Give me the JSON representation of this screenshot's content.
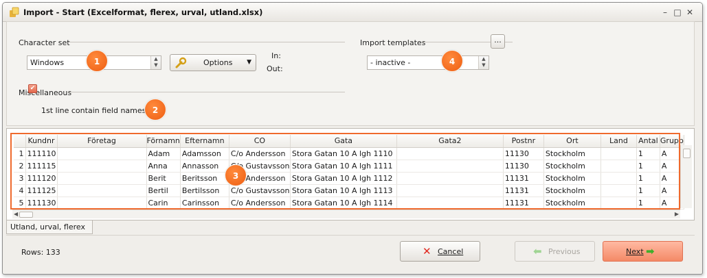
{
  "window": {
    "title": "Import - Start  (Excelformat, flerex, urval, utland.xlsx)",
    "controls": [
      "–",
      "□",
      "✕"
    ]
  },
  "character_set": {
    "section_label": "Character set",
    "value": "Windows",
    "options_label": "Options",
    "in_label": "In:",
    "out_label": "Out:"
  },
  "import_templates": {
    "section_label": "Import templates",
    "value": "- inactive -",
    "browse_label": "..."
  },
  "miscellaneous": {
    "section_label": "Miscellaneous",
    "checkbox_label": "1st line contain field names",
    "checked": true
  },
  "badges": [
    "1",
    "2",
    "3",
    "4"
  ],
  "grid": {
    "columns": [
      "Kundnr",
      "Företag",
      "Förnamn",
      "Efternamn",
      "CO",
      "Gata",
      "Gata2",
      "Postnr",
      "Ort",
      "Land",
      "Antal",
      "Grupp"
    ],
    "rows": [
      {
        "n": "1",
        "cells": [
          "111110",
          "",
          "Adam",
          "Adamsson",
          "C/o Andersson",
          "Stora Gatan 10 A lgh 1110",
          "",
          "11130",
          "Stockholm",
          "",
          "1",
          "A"
        ]
      },
      {
        "n": "2",
        "cells": [
          "111115",
          "",
          "Anna",
          "Annasson",
          "C/o Gustavsson",
          "Stora Gatan 10 A lgh 1111",
          "",
          "11130",
          "Stockholm",
          "",
          "1",
          "A"
        ]
      },
      {
        "n": "3",
        "cells": [
          "111120",
          "",
          "Berit",
          "Beritsson",
          "C/o Andersson",
          "Stora Gatan 10 A lgh 1112",
          "",
          "11131",
          "Stockholm",
          "",
          "1",
          "A"
        ]
      },
      {
        "n": "4",
        "cells": [
          "111125",
          "",
          "Bertil",
          "Bertilsson",
          "C/o Gustavsson",
          "Stora Gatan 10 A lgh 1113",
          "",
          "11131",
          "Stockholm",
          "",
          "1",
          "A"
        ]
      },
      {
        "n": "5",
        "cells": [
          "111130",
          "",
          "Carin",
          "Carinsson",
          "C/o Andersson",
          "Stora Gatan 10 A lgh 1114",
          "",
          "11131",
          "Stockholm",
          "",
          "1",
          "A"
        ]
      }
    ]
  },
  "sheet_tab": "Utland, urval, flerex",
  "footer": {
    "rows_label": "Rows: 133",
    "cancel_label": "Cancel",
    "previous_label": "Previous",
    "next_label": "Next"
  },
  "colors": {
    "badge": "#ee5e12",
    "highlight": "#ef6a2d",
    "cancel_icon": "#e0281f",
    "arrow_green": "#3fae2a"
  }
}
